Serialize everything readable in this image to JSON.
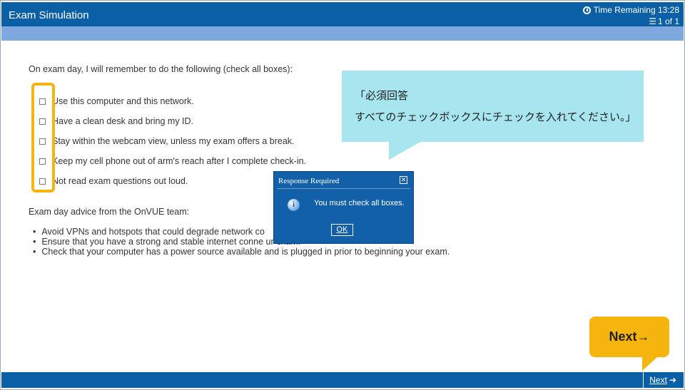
{
  "header": {
    "app_title": "Exam Simulation",
    "timer_text": "Time Remaining 13:28",
    "page_counter": "1 of 1"
  },
  "content": {
    "instruction": "On exam day, I will remember to do the following (check all boxes):",
    "checklist": [
      {
        "label": "Use this computer and this network.",
        "checked": false
      },
      {
        "label": "Have a clean desk and bring my ID.",
        "checked": false
      },
      {
        "label": "Stay within the webcam view, unless my exam offers a break.",
        "checked": false
      },
      {
        "label": "Keep my cell phone out of arm's reach after I complete check-in.",
        "checked": false
      },
      {
        "label": "Not read exam questions out loud.",
        "checked": false
      }
    ],
    "advice_title": "Exam day advice from the OnVUE team:",
    "advice_items": [
      "Avoid VPNs and hotspots that could degrade network co",
      "Ensure that you have a strong and stable internet conne                                         ur exam.",
      "Check that your computer has a power source available and is plugged in prior to beginning your exam."
    ]
  },
  "callout": {
    "line1": "「必須回答",
    "line2": "すべてのチェックボックスにチェックを入れてください。」"
  },
  "dialog": {
    "title": "Response Required",
    "close_glyph": "✕",
    "info_glyph": "i",
    "message": "You must check all boxes.",
    "ok_label": "OK"
  },
  "annotation": {
    "next_label": "Next→"
  },
  "footer": {
    "next_label": "Next",
    "next_arrow": "➔"
  },
  "colors": {
    "titlebar": "#0b5fa5",
    "subbar": "#7fa8de",
    "highlight": "#f6b40e",
    "callout": "#a7e6ee",
    "dialog": "#1260a8"
  }
}
